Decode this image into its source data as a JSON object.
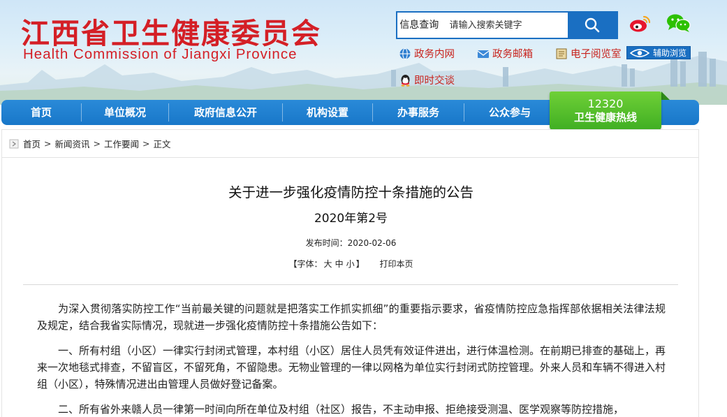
{
  "header": {
    "title_cn": "江西省卫生健康委员会",
    "title_en": "Health Commission of Jiangxi Province",
    "search": {
      "type_label": "信息查询",
      "placeholder": "请输入搜索关键字"
    },
    "social": [
      "weibo-icon",
      "wechat-icon"
    ],
    "quick_links": [
      {
        "label": "政务内网",
        "icon": "gov-intranet-icon"
      },
      {
        "label": "政务邮箱",
        "icon": "mail-icon"
      },
      {
        "label": "电子阅览室",
        "icon": "reading-room-icon"
      },
      {
        "label": "即时交谈",
        "icon": "chat-icon"
      }
    ],
    "assist_label": "辅助浏览"
  },
  "nav": {
    "items": [
      "首页",
      "单位概况",
      "政府信息公开",
      "机构设置",
      "办事服务",
      "公众参与"
    ],
    "hotline_number": "12320",
    "hotline_label": "卫生健康热线"
  },
  "breadcrumb": [
    "首页",
    "新闻资讯",
    "工作要闻",
    "正文"
  ],
  "article": {
    "title": "关于进一步强化疫情防控十条措施的公告",
    "subtitle": "2020年第2号",
    "publish_label": "发布时间：",
    "publish_date": "2020-02-06",
    "font_label": "【字体：",
    "font_sizes": [
      "大",
      "中",
      "小"
    ],
    "font_end": "】",
    "print_label": "打印本页",
    "paragraphs": [
      "为深入贯彻落实防控工作“当前最关键的问题就是把落实工作抓实抓细”的重要指示要求，省疫情防控应急指挥部依据相关法律法规及规定，结合我省实际情况，现就进一步强化疫情防控十条措施公告如下：",
      "一、所有村组（小区）一律实行封闭式管理，本村组（小区）居住人员凭有效证件进出，进行体温检测。在前期已排查的基础上，再来一次地毯式排查，不留盲区，不留死角，不留隐患。无物业管理的一律以网格为单位实行封闭式防控管理。外来人员和车辆不得进入村组（小区），特殊情况进出由管理人员做好登记备案。",
      "二、所有省外来赣人员一律第一时间向所在单位及村组（社区）报告，不主动申报、拒绝接受测温、医学观察等防控措施，"
    ]
  },
  "colors": {
    "brand_red": "#d41f26",
    "nav_blue": "#1877c9",
    "hotline_green": "#3fae22"
  }
}
